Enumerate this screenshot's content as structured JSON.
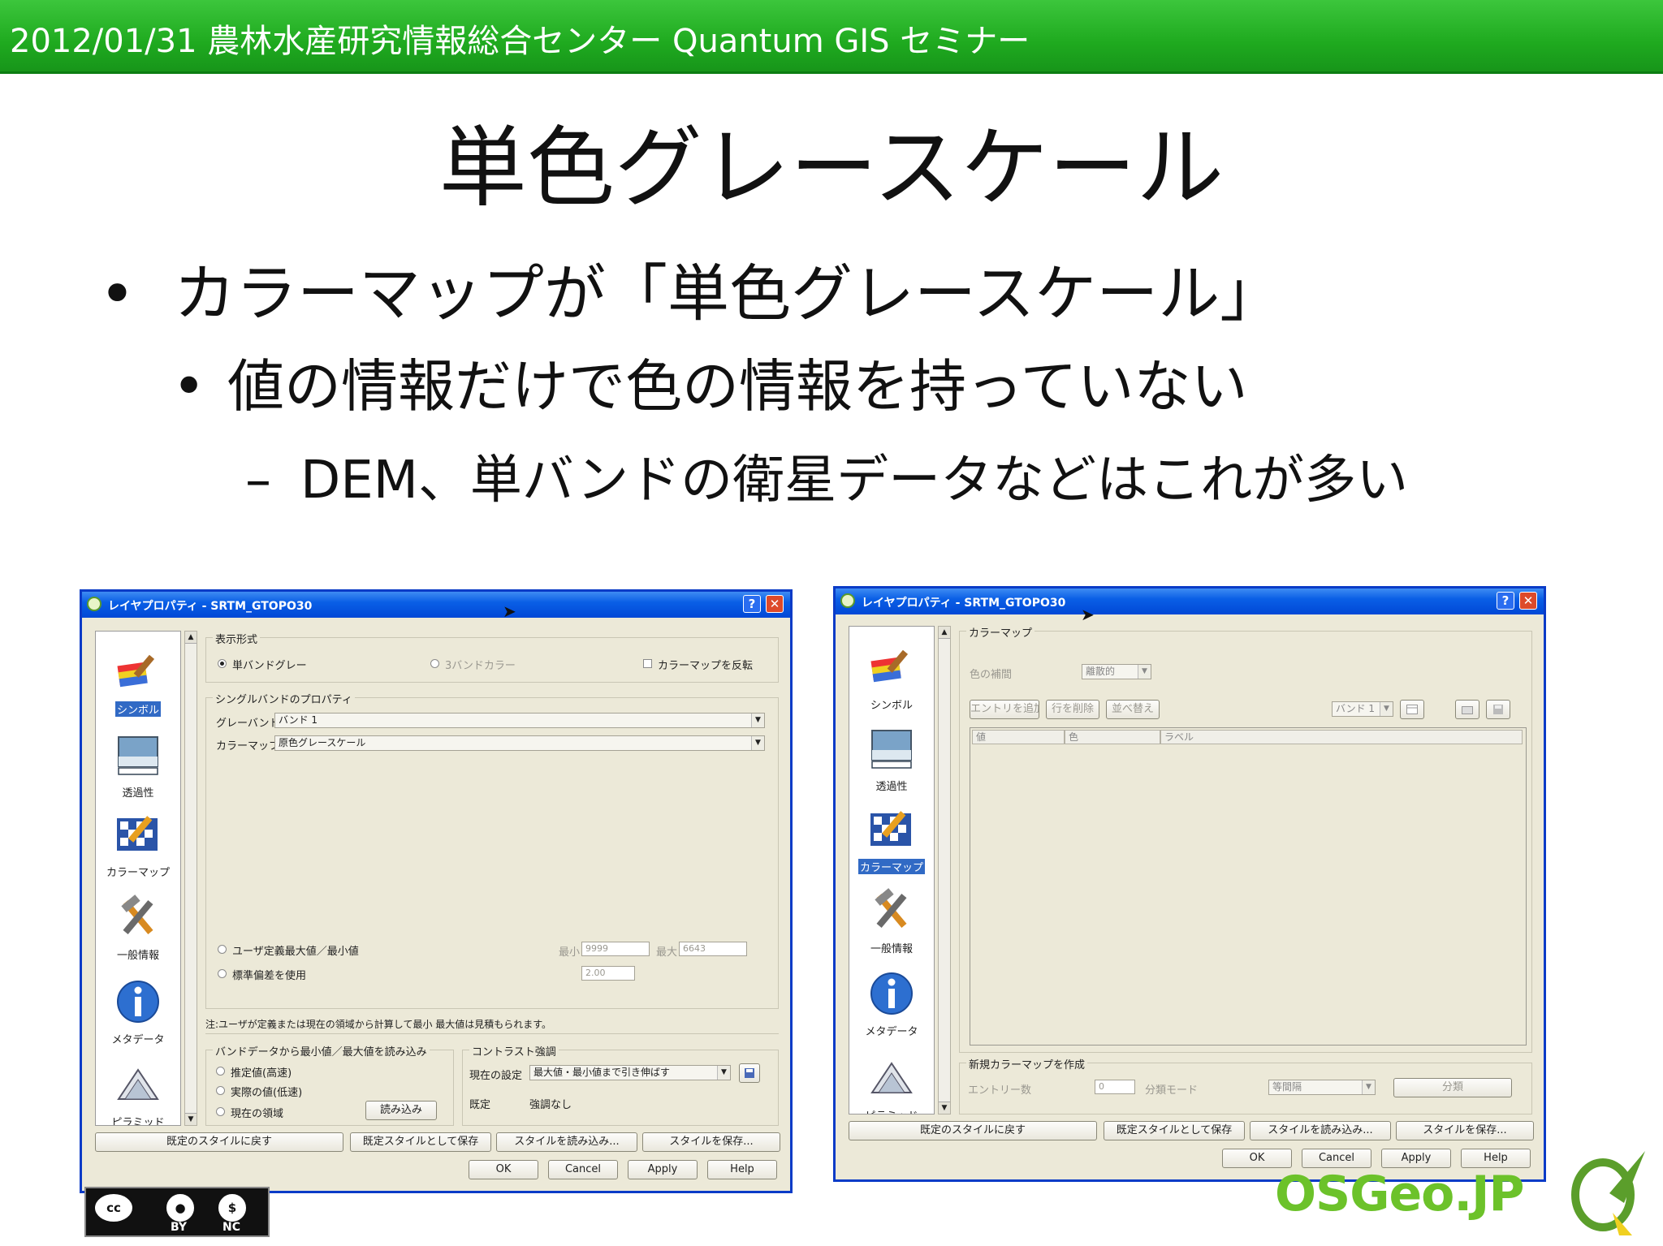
{
  "header": {
    "text": "2012/01/31 農林水産研究情報総合センター Quantum GIS セミナー"
  },
  "slide": {
    "title": "単色グレースケール",
    "bullet1": "カラーマップが「単色グレースケール」",
    "bullet2": "値の情報だけで色の情報を持っていない",
    "bullet3": "DEM、単バンドの衛星データなどはこれが多い"
  },
  "dialog1": {
    "title": "レイヤプロパティ - SRTM_GTOPO30",
    "sidebar": [
      "シンボル",
      "透過性",
      "カラーマップ",
      "一般情報",
      "メタデータ",
      "ピラミッド"
    ],
    "display_group": "表示形式",
    "radio_single": "単バンドグレー",
    "radio_three": "3バンドカラー",
    "invert_check": "カラーマップを反転",
    "single_group": "シングルバンドのプロパティ",
    "grey_band_label": "グレーバンド",
    "grey_band_value": "バンド 1",
    "colormap_label": "カラーマップ",
    "colormap_value": "原色グレースケール",
    "user_minmax": "ユーザ定義最大値／最小値",
    "std_dev": "標準偏差を使用",
    "min_label": "最小",
    "min_value": "9999",
    "max_label": "最大",
    "max_value": "6643",
    "std_value": "2.00",
    "note": "注:ユーザが定義または現在の領域から計算して最小 最大値は見積もられます。",
    "load_group": "バンドデータから最小値／最大値を読み込み",
    "load_est": "推定値(高速)",
    "load_actual": "実際の値(低速)",
    "load_current": "現在の領域",
    "load_button": "読み込み",
    "contrast_group": "コントラスト強調",
    "current_label": "現在の設定",
    "current_value": "最大値・最小値まで引き伸ばす",
    "default_label": "既定",
    "default_value": "強調なし",
    "buttons": [
      "既定のスタイルに戻す",
      "既定スタイルとして保存",
      "スタイルを読み込み...",
      "スタイルを保存..."
    ],
    "dialog_buttons": [
      "OK",
      "Cancel",
      "Apply",
      "Help"
    ]
  },
  "dialog2": {
    "title": "レイヤプロパティ - SRTM_GTOPO30",
    "sidebar": [
      "シンボル",
      "透過性",
      "カラーマップ",
      "一般情報",
      "メタデータ",
      "ピラミッド"
    ],
    "colormap_group": "カラーマップ",
    "interp_label": "色の補間",
    "interp_value": "離散的",
    "add_entry": "エントリを追加",
    "delete_row": "行を削除",
    "sort": "並べ替え",
    "band_value": "バンド 1",
    "col_value": "値",
    "col_color": "色",
    "col_label": "ラベル",
    "new_group": "新規カラーマップを作成",
    "entries_label": "エントリー数",
    "entries_value": "0",
    "mode_label": "分類モード",
    "mode_value": "等間隔",
    "classify_button": "分類",
    "buttons": [
      "既定のスタイルに戻す",
      "既定スタイルとして保存",
      "スタイルを読み込み...",
      "スタイルを保存..."
    ],
    "dialog_buttons": [
      "OK",
      "Cancel",
      "Apply",
      "Help"
    ]
  },
  "footer": {
    "cc_by": "BY",
    "cc_nc": "NC",
    "osgeo": "OSGeo.JP"
  },
  "colors": {
    "header_green": "#1faa1f",
    "titlebar_blue": "#0a5fe6",
    "dialog_bg": "#ece9d8",
    "selection": "#316ac5"
  }
}
